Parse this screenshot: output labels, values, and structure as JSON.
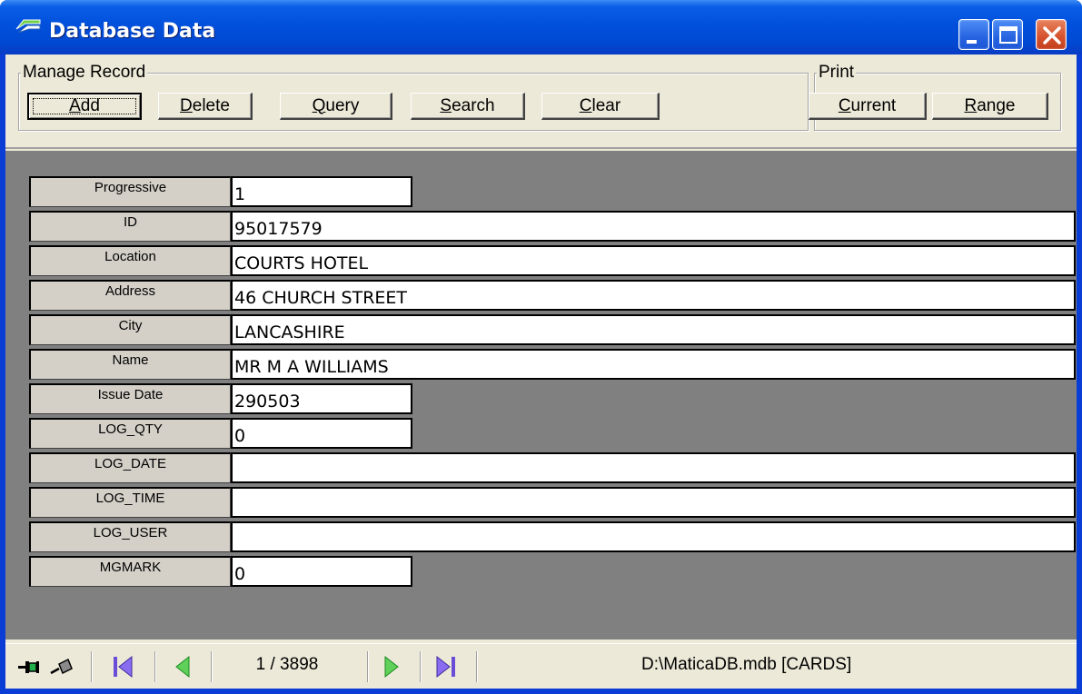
{
  "window": {
    "title": "Database Data",
    "icon": "database-app-icon",
    "controls": [
      "minimize-icon",
      "maximize-icon",
      "close-icon"
    ]
  },
  "toolbar": {
    "manage_group": {
      "legend": "Manage Record",
      "buttons": [
        {
          "label": "Add",
          "mnemonic": "A"
        },
        {
          "label": "Delete",
          "mnemonic": "D"
        },
        {
          "label": "Query",
          "mnemonic": "Q"
        },
        {
          "label": "Search",
          "mnemonic": "S"
        },
        {
          "label": "Clear",
          "mnemonic": "C"
        }
      ]
    },
    "print_group": {
      "legend": "Print",
      "buttons": [
        {
          "label": "Current",
          "mnemonic": "C"
        },
        {
          "label": "Range",
          "mnemonic": "R"
        }
      ]
    }
  },
  "record": {
    "fields": [
      {
        "label": "Progressive",
        "value": "1"
      },
      {
        "label": "ID",
        "value": "95017579"
      },
      {
        "label": "Location",
        "value": "COURTS HOTEL"
      },
      {
        "label": "Address",
        "value": "46 CHURCH STREET"
      },
      {
        "label": "City",
        "value": "LANCASHIRE"
      },
      {
        "label": "Name",
        "value": "MR M A WILLIAMS"
      },
      {
        "label": "Issue Date",
        "value": "290503"
      },
      {
        "label": "LOG_QTY",
        "value": "0"
      },
      {
        "label": "LOG_DATE",
        "value": ""
      },
      {
        "label": "LOG_TIME",
        "value": ""
      },
      {
        "label": "LOG_USER",
        "value": ""
      },
      {
        "label": "MGMARK",
        "value": "0"
      }
    ]
  },
  "statusbar": {
    "icons": [
      "pin-icon",
      "unpin-icon",
      "first-record-icon",
      "previous-record-icon",
      "next-record-icon",
      "last-record-icon"
    ],
    "counter": "1 / 3898",
    "path": "D:\\MaticaDB.mdb [CARDS]"
  },
  "colors": {
    "titlebar_blue": "#0150dc",
    "data_area_gray": "#808080",
    "nav_green": "#22b14c",
    "nav_purple": "#6a4cd6"
  }
}
